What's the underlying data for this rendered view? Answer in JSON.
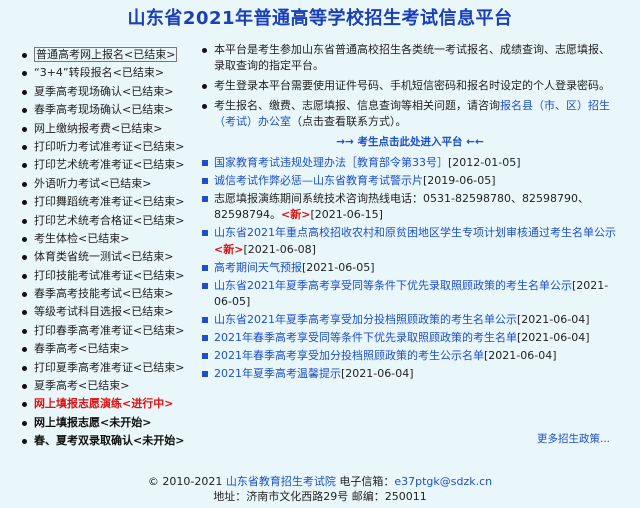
{
  "page_title": "山东省2021年普通高等学校招生考试信息平台",
  "sidebar": [
    {
      "label": "普通高考网上报名<已结束>",
      "state": "first"
    },
    {
      "label": "“3+4”转段报名<已结束>",
      "state": ""
    },
    {
      "label": "夏季高考现场确认<已结束>",
      "state": ""
    },
    {
      "label": "春季高考现场确认<已结束>",
      "state": ""
    },
    {
      "label": "网上缴纳报考费<已结束>",
      "state": ""
    },
    {
      "label": "打印听力考试准考证<已结束>",
      "state": ""
    },
    {
      "label": "打印艺术统考准考证<已结束>",
      "state": ""
    },
    {
      "label": "外语听力考试<已结束>",
      "state": ""
    },
    {
      "label": "打印舞蹈统考准考证<已结束>",
      "state": ""
    },
    {
      "label": "打印艺术统考合格证<已结束>",
      "state": ""
    },
    {
      "label": "考生体检<已结束>",
      "state": ""
    },
    {
      "label": "体育类省统一测试<已结束>",
      "state": ""
    },
    {
      "label": "打印技能考试准考证<已结束>",
      "state": ""
    },
    {
      "label": "春季高考技能考试<已结束>",
      "state": ""
    },
    {
      "label": "等级考试科目选报<已结束>",
      "state": ""
    },
    {
      "label": "打印春季高考准考证<已结束>",
      "state": ""
    },
    {
      "label": "春季高考<已结束>",
      "state": ""
    },
    {
      "label": "打印夏季高考准考证<已结束>",
      "state": ""
    },
    {
      "label": "夏季高考<已结束>",
      "state": ""
    },
    {
      "label": "网上填报志愿演练<进行中>",
      "state": "active"
    },
    {
      "label": "网上填报志愿<未开始>",
      "state": "bold"
    },
    {
      "label": "春、夏考双录取确认<未开始>",
      "state": "bold"
    }
  ],
  "notices": {
    "n1": "本平台是考生参加山东省普通高校招生各类统一考试报名、成绩查询、志愿填报、录取查询的指定平台。",
    "n2": "考生登录本平台需要使用证件号码、手机短信密码和报名时设定的个人登录密码。",
    "n3_pre": "考生报名、缴费、志愿填报、信息查询等相关问题，请咨询",
    "n3_link": "报名县（市、区）招生（考试）办公室",
    "n3_post": "（点击查看联系方式）。"
  },
  "entry_link": "→→ 考生点击此处进入平台 ←←",
  "news": [
    {
      "title": "国家教育考试违规处理办法［教育部令第33号］",
      "date": "[2012-01-05]",
      "new": "",
      "black": false
    },
    {
      "title": "诚信考试作弊必惩—山东省教育考试警示片",
      "date": "[2019-06-05]",
      "new": "",
      "black": false
    },
    {
      "title": "志愿填报演练期间系统技术咨询热线电话：0531-82598780、82598790、82598794。",
      "date": "[2021-06-15]",
      "new": "<新>",
      "black": true
    },
    {
      "title": "山东省2021年重点高校招收农村和原贫困地区学生专项计划审核通过考生名单公示",
      "date": "[2021-06-08]",
      "new": "<新>",
      "black": false
    },
    {
      "title": "高考期间天气预报",
      "date": "[2021-06-05]",
      "new": "",
      "black": false
    },
    {
      "title": "山东省2021年夏季高考享受同等条件下优先录取照顾政策的考生名单公示",
      "date": "[2021-06-05]",
      "new": "",
      "black": false
    },
    {
      "title": "山东省2021年夏季高考享受加分投档照顾政策的考生名单公示",
      "date": "[2021-06-04]",
      "new": "",
      "black": false
    },
    {
      "title": "2021年春季高考享受同等条件下优先录取照顾政策的考生名单",
      "date": "[2021-06-04]",
      "new": "",
      "black": false
    },
    {
      "title": "2021年春季高考享受加分投档照顾政策的考生公示名单",
      "date": "[2021-06-04]",
      "new": "",
      "black": false
    },
    {
      "title": "2021年夏季高考温馨提示",
      "date": "[2021-06-04]",
      "new": "",
      "black": false
    }
  ],
  "more_link": "更多招生政策...",
  "footer": {
    "line1_pre": "© 2010-2021",
    "org": "山东省教育招生考试院",
    "email_label": "电子信箱：",
    "email": "e37ptgk@sdzk.cn",
    "line2": "地址：济南市文化西路29号 邮编：250011"
  }
}
